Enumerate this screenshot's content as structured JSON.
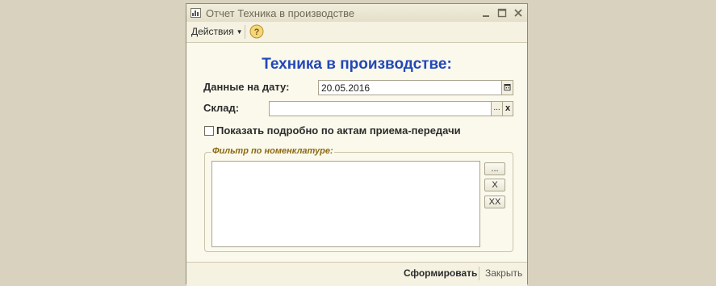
{
  "window": {
    "title": "Отчет  Техника в производстве"
  },
  "toolbar": {
    "actions_label": "Действия",
    "help_label": "?"
  },
  "form": {
    "title": "Техника в производстве:",
    "date_label": "Данные на дату:",
    "date_value": "20.05.2016",
    "sklad_label": "Склад:",
    "sklad_value": "",
    "select_button": "...",
    "clear_button": "x",
    "checkbox_label": "Показать подробно по актам приема-передачи",
    "checkbox_checked": false
  },
  "filter": {
    "legend": "Фильтр по номенклатуре:",
    "items": [],
    "select_button": "...",
    "remove_button": "X",
    "remove_all_button": "XX"
  },
  "footer": {
    "generate_label": "Сформировать",
    "close_label": "Закрыть"
  },
  "colors": {
    "title_blue": "#2248b8",
    "legend_gold": "#8b6a12",
    "window_bg": "#fbf9ec",
    "desktop_bg": "#d8d2bf"
  }
}
